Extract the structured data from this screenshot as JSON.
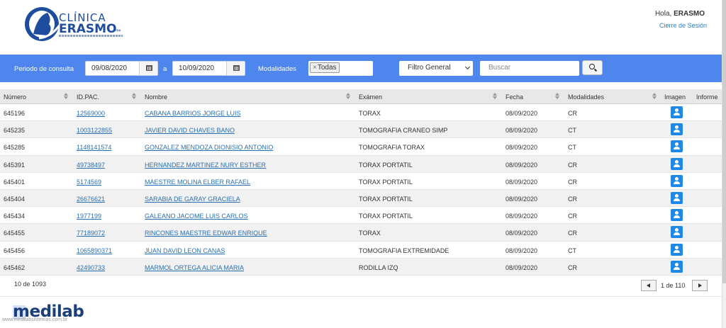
{
  "header": {
    "logo_line1": "CLÍNICA",
    "logo_line2": "ERASMO",
    "logo_suffix": "LTDA",
    "greeting_prefix": "Hola,",
    "user": "ERASMO",
    "logout_label": "Cierre de Sesión"
  },
  "filters": {
    "period_label": "Periodo de consulta",
    "date_from": "09/08/2020",
    "to_label": "a",
    "date_to": "10/09/2020",
    "modalities_label": "Modalidades",
    "modality_tag": "Todas",
    "general_filter": "Filtro General",
    "search_placeholder": "Buscar"
  },
  "table": {
    "columns": [
      "Número",
      "ID.PAC.",
      "Nombre",
      "Exámen",
      "Fecha",
      "Modalidades",
      "Imagen",
      "Informe"
    ],
    "rows": [
      {
        "numero": "645196",
        "id": "12569000",
        "nombre": "CABANA BARRIOS JORGE LUIS",
        "examen": "TORAX",
        "fecha": "08/09/2020",
        "modalidad": "CR"
      },
      {
        "numero": "645235",
        "id": "1003122855",
        "nombre": "JAVIER DAVID CHAVES BANO",
        "examen": "TOMOGRAFIA CRANEO SIMP",
        "fecha": "08/09/2020",
        "modalidad": "CT"
      },
      {
        "numero": "645285",
        "id": "1148141574",
        "nombre": "GONZALEZ MENDOZA DIONISIO ANTONIO",
        "examen": "TOMOGRAFIA TORAX",
        "fecha": "08/09/2020",
        "modalidad": "CT"
      },
      {
        "numero": "645391",
        "id": "49738497",
        "nombre": "HERNANDEZ MARTINEZ NURY ESTHER",
        "examen": "TORAX PORTATIL",
        "fecha": "08/09/2020",
        "modalidad": "CR"
      },
      {
        "numero": "645401",
        "id": "5174569",
        "nombre": "MAESTRE MOLINA ELBER RAFAEL",
        "examen": "TORAX PORTATIL",
        "fecha": "08/09/2020",
        "modalidad": "CR"
      },
      {
        "numero": "645404",
        "id": "26676621",
        "nombre": "SARABIA DE GARAY GRACIELA",
        "examen": "TORAX PORTATIL",
        "fecha": "08/09/2020",
        "modalidad": "CR"
      },
      {
        "numero": "645434",
        "id": "1977199",
        "nombre": "GALEANO JACOME LUIS CARLOS",
        "examen": "TORAX PORTATIL",
        "fecha": "08/09/2020",
        "modalidad": "CR"
      },
      {
        "numero": "645455",
        "id": "77189072",
        "nombre": "RINCONES MAESTRE EDWAR ENRIQUE",
        "examen": "TORAX",
        "fecha": "08/09/2020",
        "modalidad": "CR"
      },
      {
        "numero": "645456",
        "id": "1065890371",
        "nombre": "JUAN DAVID LEON CANAS",
        "examen": "TOMOGRAFIA EXTREMIDADE",
        "fecha": "08/09/2020",
        "modalidad": "CT"
      },
      {
        "numero": "645462",
        "id": "42490733",
        "nombre": "MARMOL ORTEGA ALICIA MARIA",
        "examen": "RODILLA IZQ",
        "fecha": "08/09/2020",
        "modalidad": "CR"
      }
    ]
  },
  "footer": {
    "count": "10 de 1093",
    "page": "1 de 110"
  },
  "branding": {
    "vendor": "medilab",
    "vendor_url": "www.medilabsistemas.com.br"
  },
  "colors": {
    "filter_bar": "#4f86ee",
    "link": "#2a6fb0",
    "image_button": "#1e88e5",
    "logo": "#1f4d9e"
  }
}
